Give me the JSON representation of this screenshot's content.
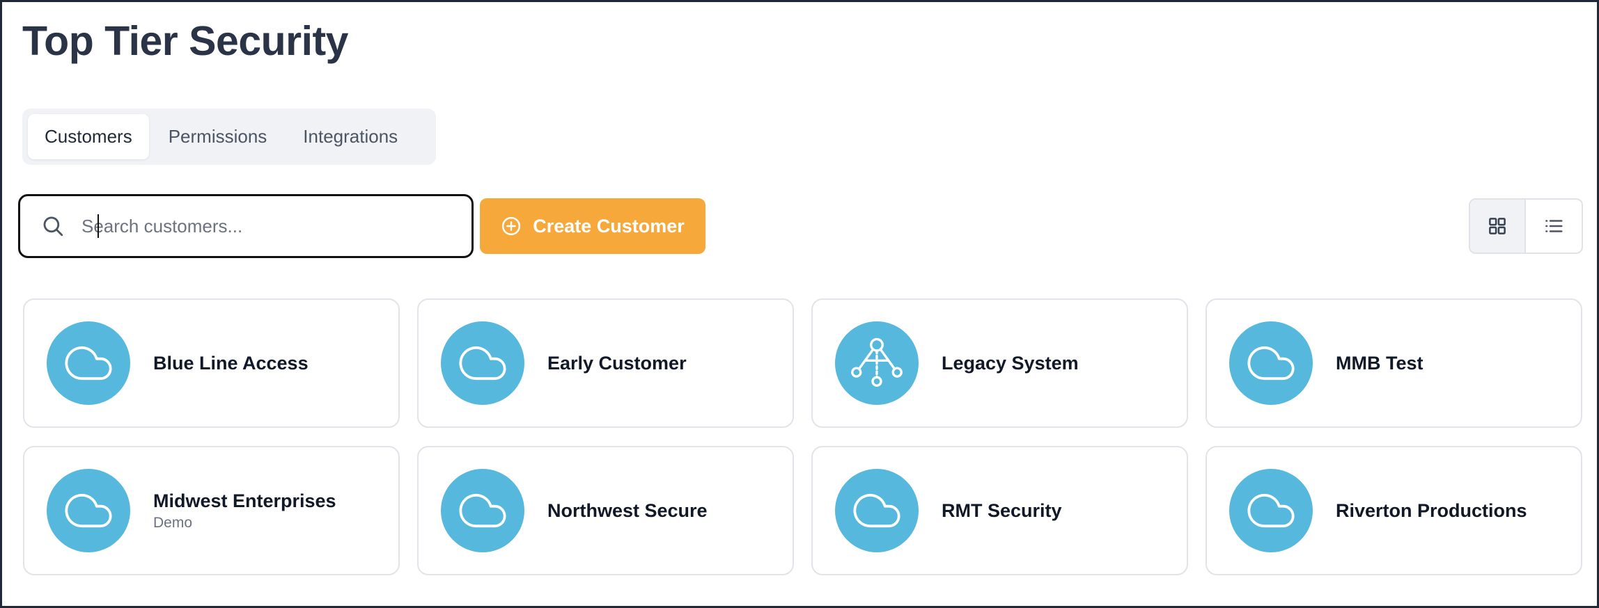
{
  "page": {
    "title": "Top Tier Security"
  },
  "tabs": [
    {
      "label": "Customers",
      "active": true
    },
    {
      "label": "Permissions",
      "active": false
    },
    {
      "label": "Integrations",
      "active": false
    }
  ],
  "search": {
    "placeholder": "Search customers...",
    "value": "",
    "icon": "search-icon"
  },
  "create_button": {
    "label": "Create Customer",
    "icon": "plus-circle-icon",
    "color": "#f6a83b"
  },
  "view_toggle": {
    "selected": "grid",
    "options": [
      "grid-view-icon",
      "list-view-icon"
    ]
  },
  "colors": {
    "avatar": "#55b8dc",
    "title": "#2b3447"
  },
  "customers": [
    {
      "name": "Blue Line Access",
      "subtitle": "",
      "icon": "cloud-icon"
    },
    {
      "name": "Early Customer",
      "subtitle": "",
      "icon": "cloud-icon"
    },
    {
      "name": "Legacy System",
      "subtitle": "",
      "icon": "network-icon"
    },
    {
      "name": "MMB Test",
      "subtitle": "",
      "icon": "cloud-icon"
    },
    {
      "name": "Midwest Enterprises",
      "subtitle": "Demo",
      "icon": "cloud-icon"
    },
    {
      "name": "Northwest Secure",
      "subtitle": "",
      "icon": "cloud-icon"
    },
    {
      "name": "RMT Security",
      "subtitle": "",
      "icon": "cloud-icon"
    },
    {
      "name": "Riverton Productions",
      "subtitle": "",
      "icon": "cloud-icon"
    }
  ]
}
